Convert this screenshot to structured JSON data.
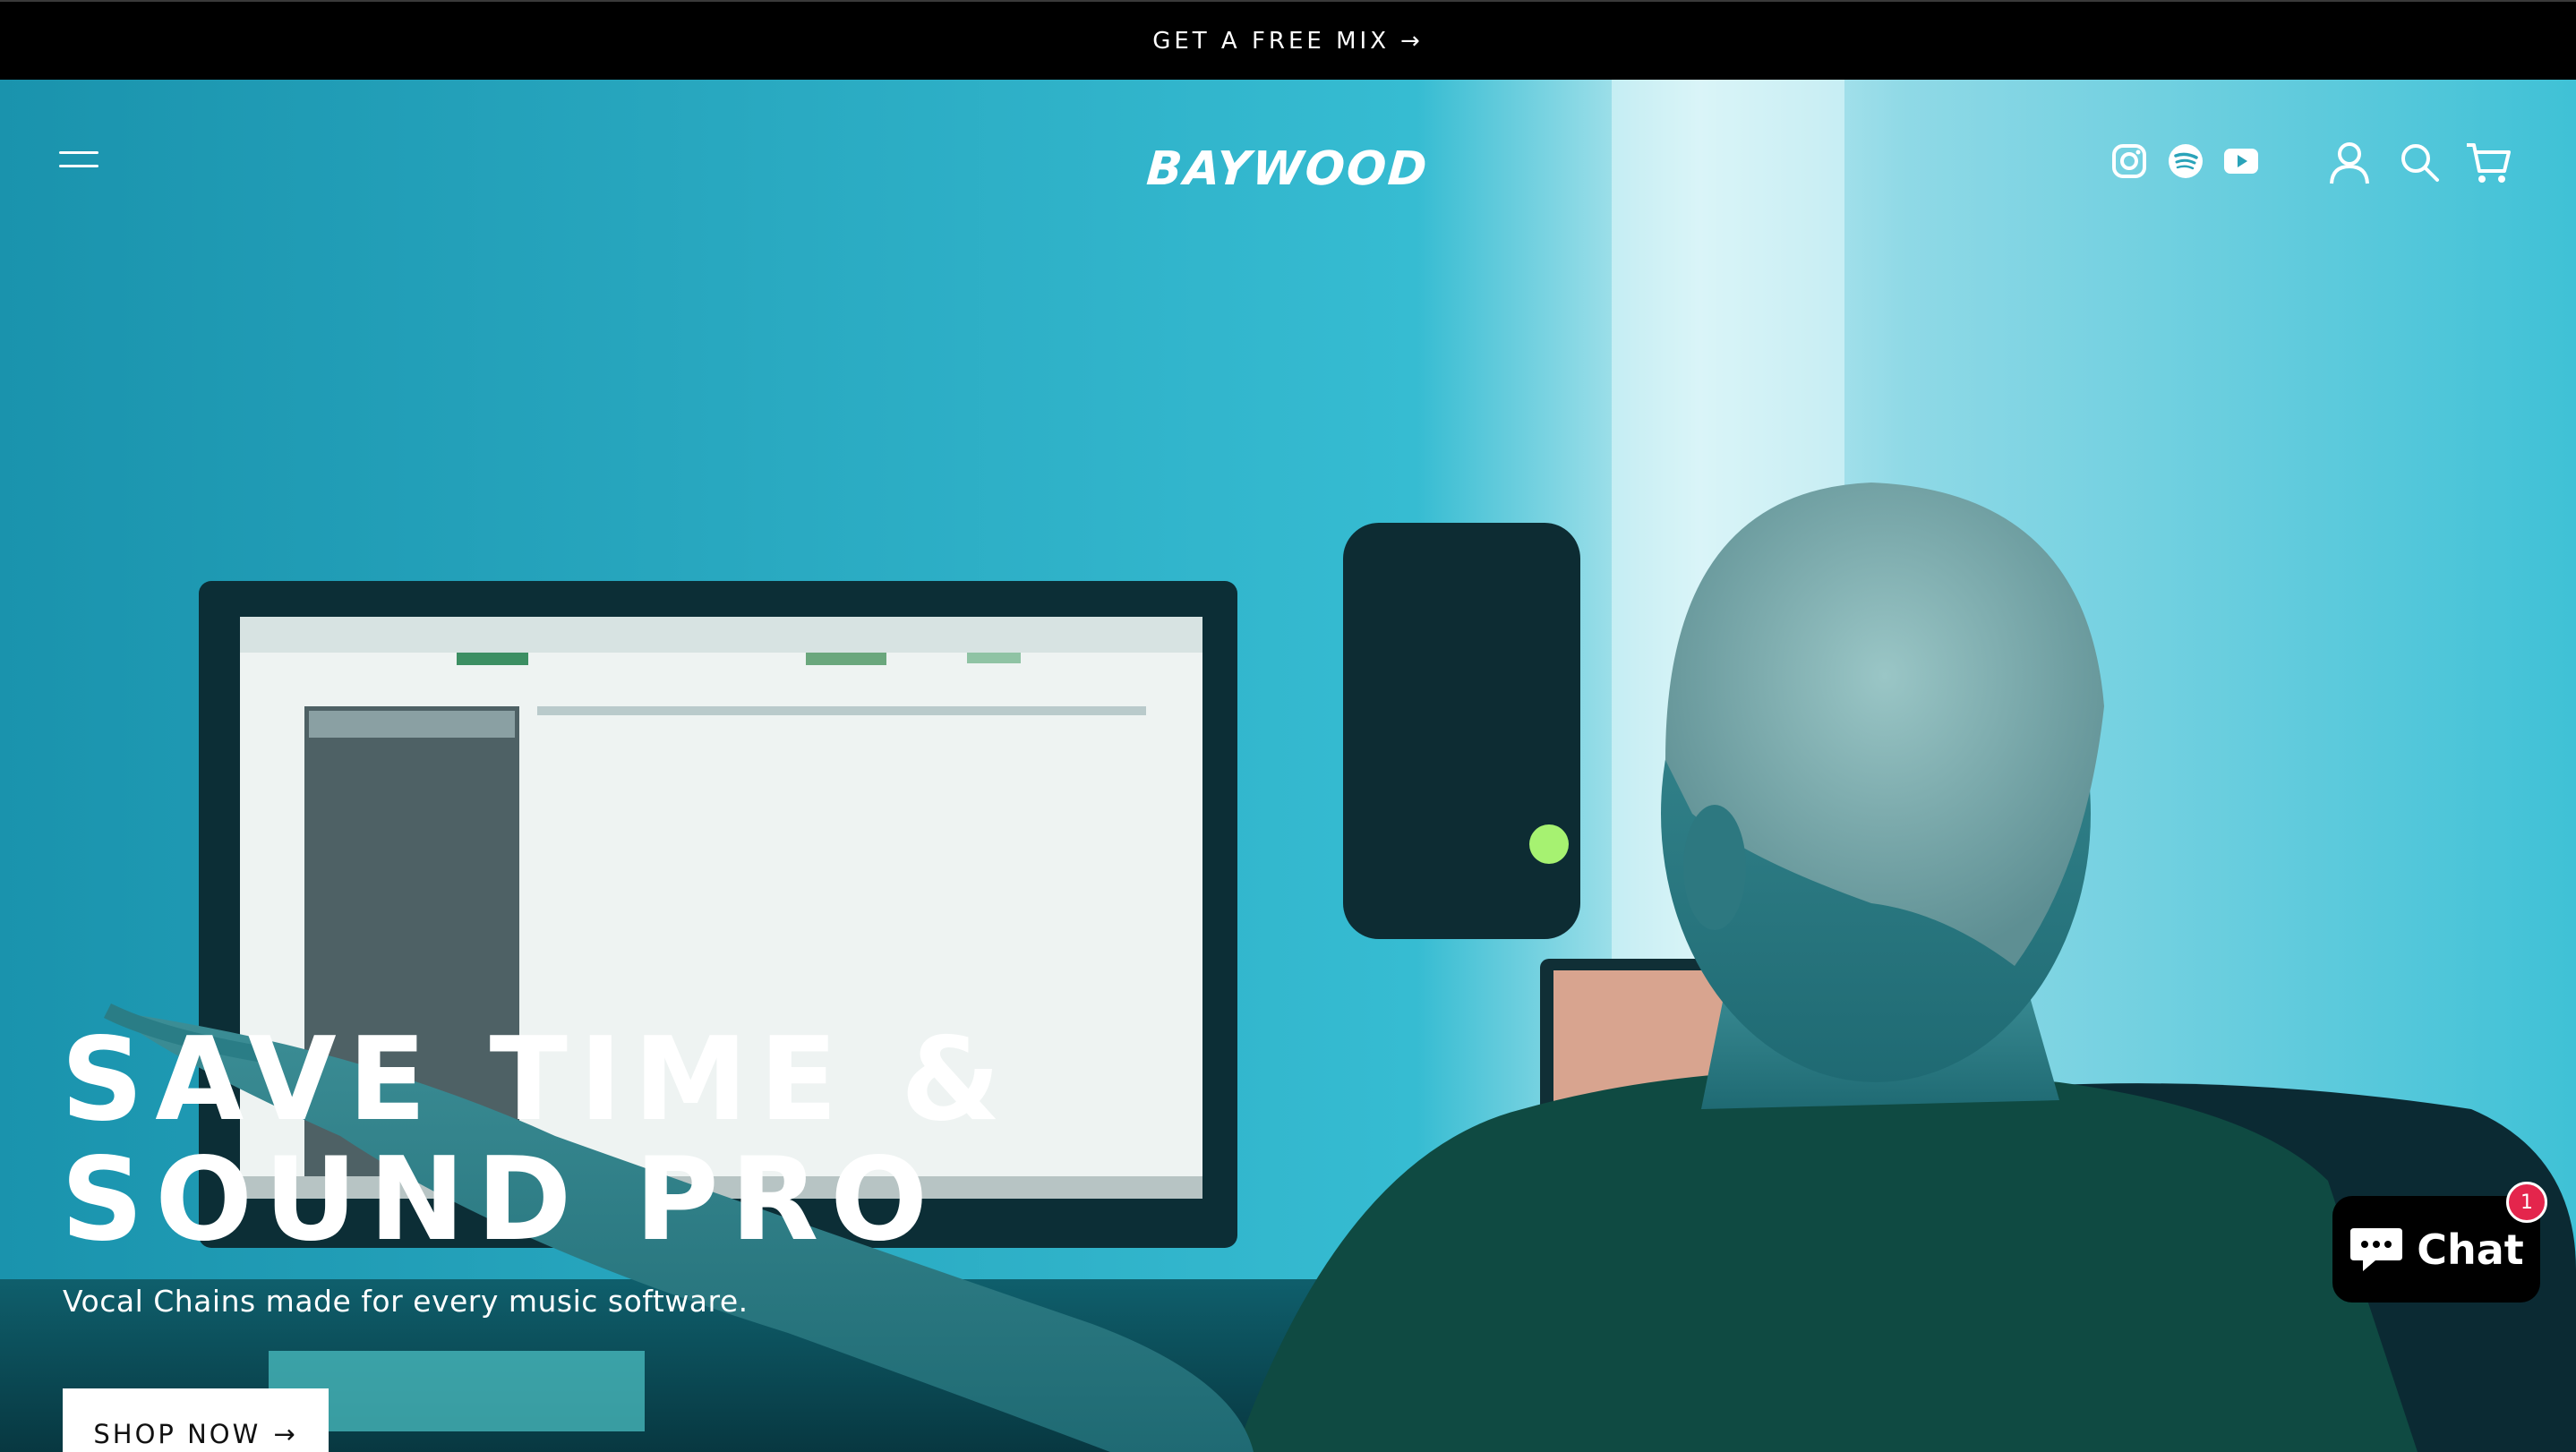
{
  "announcement": {
    "text": "GET A FREE MIX",
    "arrow": "→"
  },
  "header": {
    "logo_text": "BAYWOOD",
    "menu_icon": "hamburger-menu-icon",
    "social_icons": [
      "instagram-icon",
      "spotify-icon",
      "youtube-icon"
    ],
    "action_icons": [
      "account-icon",
      "search-icon",
      "cart-icon"
    ]
  },
  "hero": {
    "headline_line1": "SAVE TIME &",
    "headline_line2": "SOUND PRO",
    "subheading": "Vocal Chains made for every music software.",
    "cta_label": "SHOP NOW",
    "cta_arrow": "→"
  },
  "chat": {
    "label": "Chat",
    "badge_count": "1",
    "icon": "chat-bubble-icon"
  },
  "colors": {
    "announcement_bg": "#000000",
    "hero_teal": "#2fb3c9",
    "chat_badge": "#e4254c"
  }
}
